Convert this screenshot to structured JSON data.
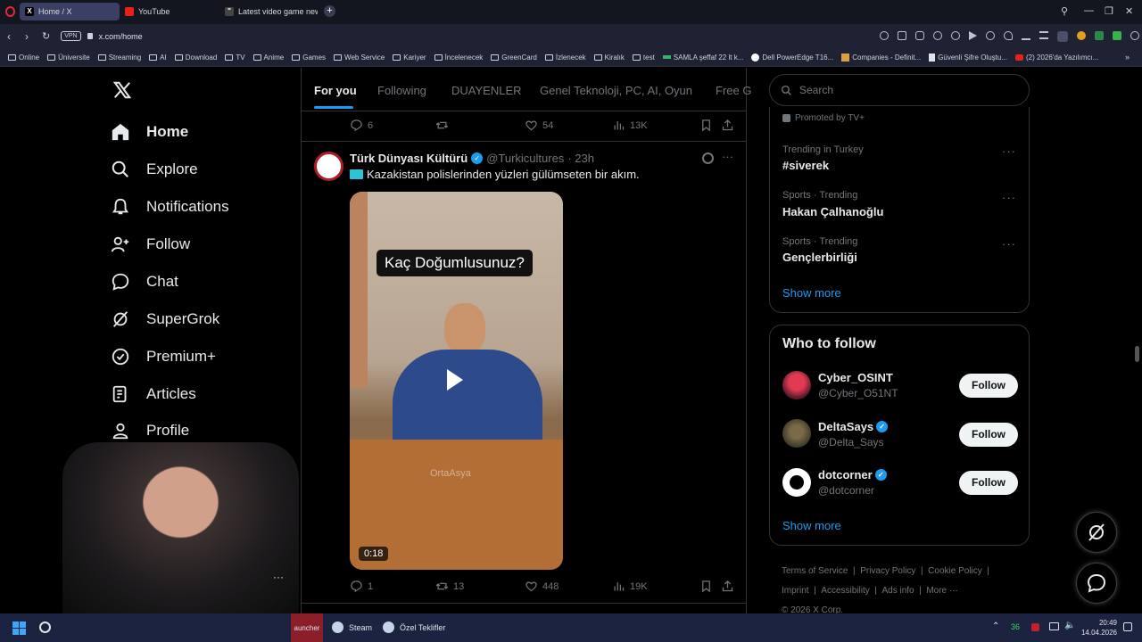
{
  "browser": {
    "tabs": [
      {
        "label": "Home / X",
        "icon": "x-logo"
      },
      {
        "label": "YouTube",
        "icon": "youtube-logo"
      },
      {
        "label": "Latest video game news -",
        "icon": "news-logo"
      }
    ],
    "vpn_label": "VPN",
    "url": "x.com/home",
    "bookmarks": [
      "Online",
      "Üniversite",
      "Streaming",
      "AI",
      "Download",
      "TV",
      "Anime",
      "Games",
      "Web Service",
      "Kariyer",
      "İncelenecek",
      "GreenCard",
      "İzlenecek",
      "Kiralık",
      "test",
      "SAMLA şeffaf 22 lt k...",
      "Dell PowerEdge T16...",
      "Companies - Definit...",
      "Güvenli Şifre Oluştu...",
      "(2) 2026'da Yazılımcı..."
    ]
  },
  "sidebar": {
    "items": [
      {
        "label": "Home",
        "icon": "home-icon"
      },
      {
        "label": "Explore",
        "icon": "search-icon"
      },
      {
        "label": "Notifications",
        "icon": "bell-icon"
      },
      {
        "label": "Follow",
        "icon": "follow-icon"
      },
      {
        "label": "Chat",
        "icon": "chat-icon"
      },
      {
        "label": "SuperGrok",
        "icon": "grok-icon"
      },
      {
        "label": "Premium+",
        "icon": "premium-icon"
      },
      {
        "label": "Articles",
        "icon": "articles-icon"
      },
      {
        "label": "Profile",
        "icon": "profile-icon"
      }
    ]
  },
  "feed": {
    "tabs": [
      "For you",
      "Following",
      "DUAYENLER",
      "Genel Teknoloji, PC, AI, Oyun",
      "Free G"
    ],
    "prev_post_stats": {
      "replies": "6",
      "reposts": "",
      "likes": "54",
      "views": "13K"
    },
    "post": {
      "author": "Türk Dünyası Kültürü",
      "handle": "@Turkicultures",
      "time": "· 23h",
      "text": "Kazakistan polislerinden yüzleri gülümseten bir akım.",
      "video_caption": "Kaç Doğumlusunuz?",
      "video_duration": "0:18",
      "watermark": "OrtaAsya",
      "stats": {
        "replies": "1",
        "reposts": "13",
        "likes": "448",
        "views": "19K"
      }
    }
  },
  "right": {
    "search_placeholder": "Search",
    "promoted": "Promoted by TV+",
    "trends": [
      {
        "meta": "Trending in Turkey",
        "name": "#siverek"
      },
      {
        "meta": "Sports · Trending",
        "name": "Hakan Çalhanoğlu"
      },
      {
        "meta": "Sports · Trending",
        "name": "Gençlerbirliği"
      }
    ],
    "trends_show_more": "Show more",
    "who_to_follow_title": "Who to follow",
    "accounts": [
      {
        "name": "Cyber_OSINT",
        "handle": "@Cyber_O51NT",
        "verified": false,
        "button": "Follow"
      },
      {
        "name": "DeltaSays",
        "handle": "@Delta_Says",
        "verified": true,
        "button": "Follow"
      },
      {
        "name": "dotcorner",
        "handle": "@dotcorner",
        "verified": true,
        "button": "Follow"
      }
    ],
    "follow_show_more": "Show more",
    "footer": [
      "Terms of Service",
      "Privacy Policy",
      "Cookie Policy",
      "Imprint",
      "Accessibility",
      "Ads info",
      "More ···"
    ],
    "copyright": "© 2026 X Corp."
  },
  "taskbar": {
    "apps": [
      "auncher",
      "Steam",
      "Özel Teklifler"
    ],
    "tray_number": "36",
    "time": "20:49",
    "date": "14.04.2026"
  },
  "colors": {
    "accent": "#1d9bf0",
    "background": "#000000",
    "muted": "#71767b"
  }
}
